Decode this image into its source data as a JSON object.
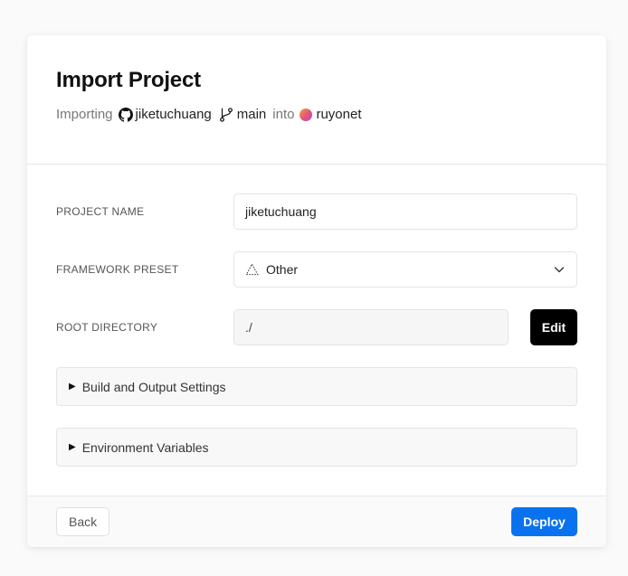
{
  "header": {
    "title": "Import Project",
    "importing_label": "Importing",
    "repo_name": "jiketuchuang",
    "branch_name": "main",
    "into_label": "into",
    "team_name": "ruyonet"
  },
  "form": {
    "project_name": {
      "label": "PROJECT NAME",
      "value": "jiketuchuang"
    },
    "framework_preset": {
      "label": "FRAMEWORK PRESET",
      "value": "Other",
      "icon": "triangle-outline-icon"
    },
    "root_directory": {
      "label": "ROOT DIRECTORY",
      "value": "./",
      "edit_label": "Edit"
    }
  },
  "sections": [
    {
      "label": "Build and Output Settings"
    },
    {
      "label": "Environment Variables"
    }
  ],
  "footer": {
    "back_label": "Back",
    "deploy_label": "Deploy"
  },
  "colors": {
    "deploy": "#0a72ef",
    "edit": "#000000"
  }
}
